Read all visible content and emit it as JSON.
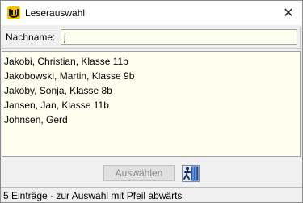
{
  "window": {
    "title": "Leserauswahl",
    "close_glyph": "✕",
    "icon": "app-logo-icon"
  },
  "search": {
    "label": "Nachname:",
    "value": "j"
  },
  "results": [
    {
      "text": "Jakobi, Christian, Klasse 11b"
    },
    {
      "text": "Jakobowski, Martin, Klasse 9b"
    },
    {
      "text": "Jakoby, Sonja, Klasse 8b"
    },
    {
      "text": "Jansen, Jan, Klasse 11b"
    },
    {
      "text": "Johnsen, Gerd"
    }
  ],
  "buttons": {
    "select_label": "Auswählen",
    "exit_icon": "exit-door-icon"
  },
  "status": {
    "text": "5 Einträge - zur Auswahl mit Pfeil abwärts"
  },
  "colors": {
    "field_bg": "#fffff0",
    "window_bg": "#f0f0f0",
    "disabled_text": "#8a8a8a"
  }
}
